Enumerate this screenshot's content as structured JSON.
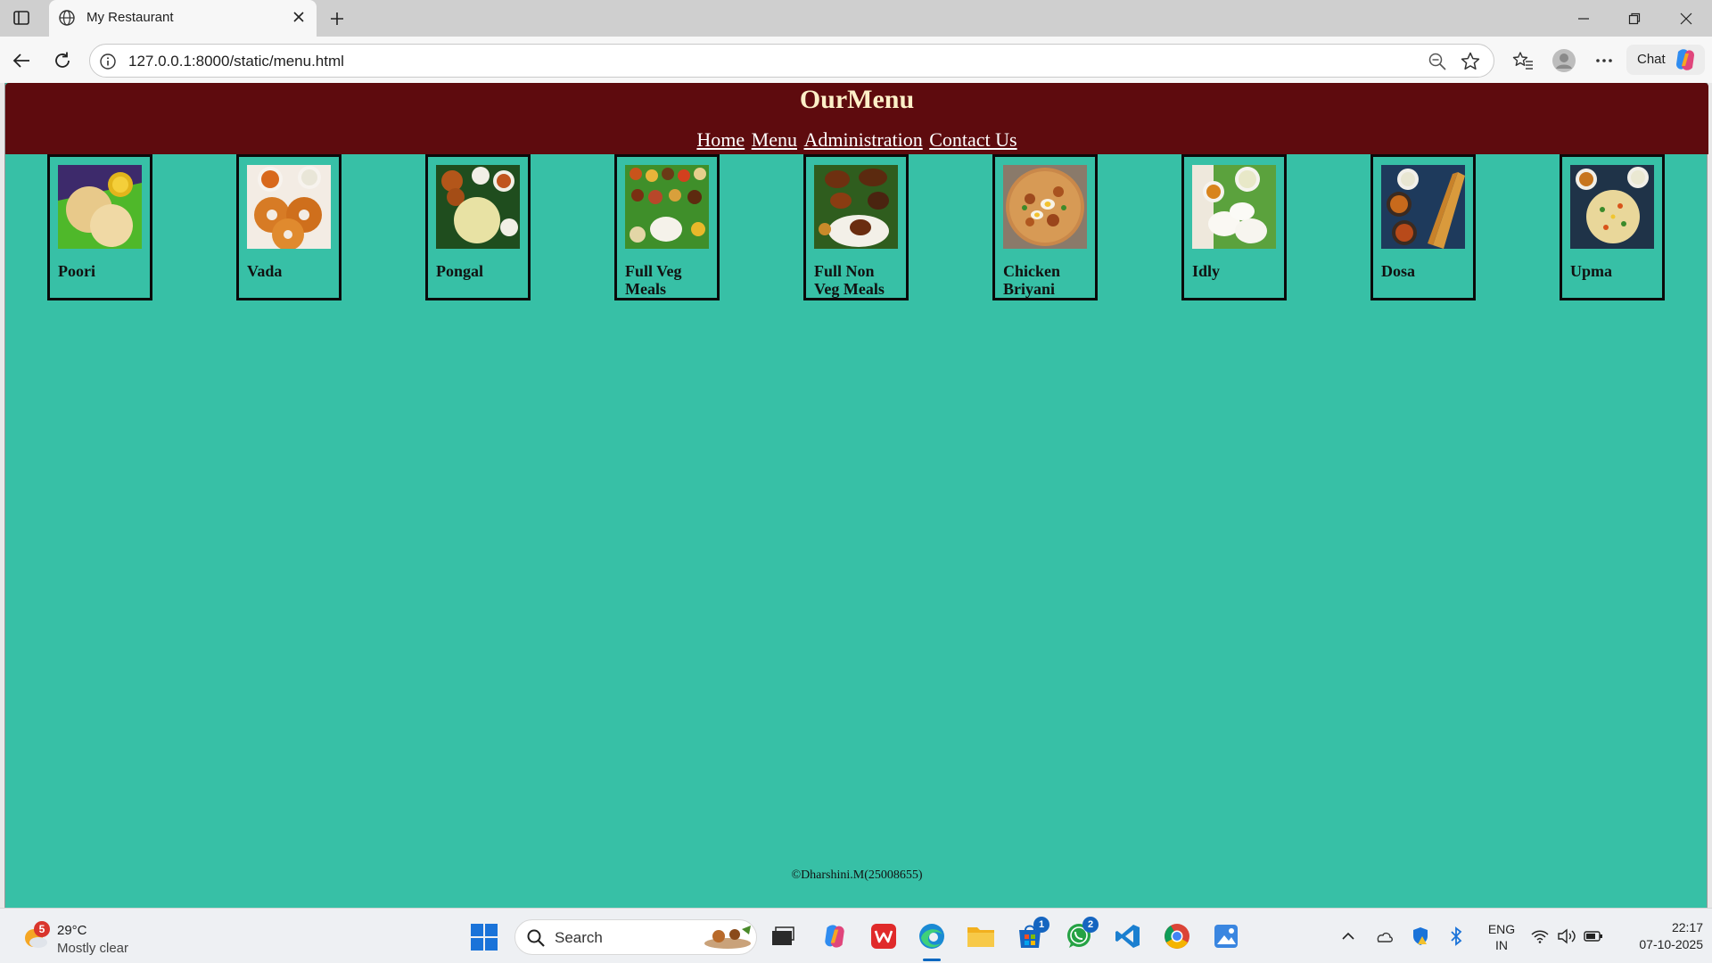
{
  "browser": {
    "tab_title": "My Restaurant",
    "url": "127.0.0.1:8000/static/menu.html",
    "chat_label": "Chat"
  },
  "page": {
    "title": "OurMenu",
    "nav": [
      {
        "label": "Home"
      },
      {
        "label": "Menu"
      },
      {
        "label": "Administration"
      },
      {
        "label": "Contact Us"
      }
    ],
    "menu_items": [
      {
        "name": "Poori"
      },
      {
        "name": "Vada"
      },
      {
        "name": "Pongal"
      },
      {
        "name": "Full Veg Meals"
      },
      {
        "name": "Full Non Veg Meals"
      },
      {
        "name": "Chicken Briyani"
      },
      {
        "name": "Idly"
      },
      {
        "name": "Dosa"
      },
      {
        "name": "Upma"
      }
    ],
    "footer": "©Dharshini.M(25008655)"
  },
  "taskbar": {
    "weather_temp": "29°C",
    "weather_condition": "Mostly clear",
    "weather_badge": "5",
    "search_label": "Search",
    "store_badge": "1",
    "whatsapp_badge": "2",
    "lang_line1": "ENG",
    "lang_line2": "IN",
    "time": "22:17",
    "date": "07-10-2025"
  },
  "colors": {
    "header_bg": "#5e0b0e",
    "page_bg": "#37c0a6",
    "title_color": "#fdf0c8"
  }
}
